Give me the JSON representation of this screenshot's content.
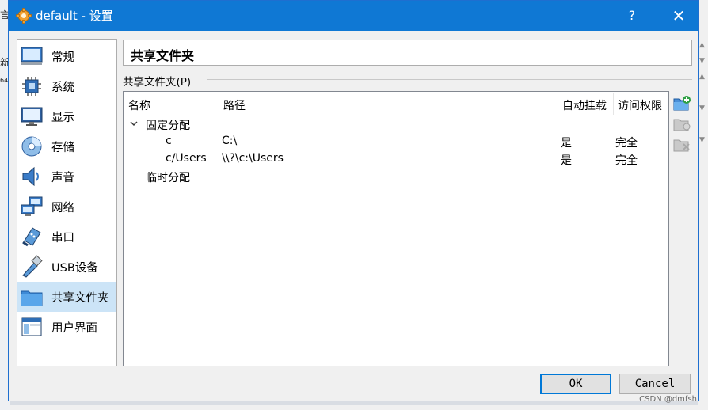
{
  "window": {
    "title": "default - 设置",
    "help_label": "?",
    "close_label": "✕",
    "title_icon": "gear-icon"
  },
  "background": {
    "left_fragments": [
      "言",
      "新",
      "64"
    ]
  },
  "nav": {
    "selected_index": 8,
    "items": [
      {
        "label": "常规",
        "icon": "monitor-general-icon"
      },
      {
        "label": "系统",
        "icon": "chip-icon"
      },
      {
        "label": "显示",
        "icon": "display-icon"
      },
      {
        "label": "存储",
        "icon": "disk-icon"
      },
      {
        "label": "声音",
        "icon": "speaker-icon"
      },
      {
        "label": "网络",
        "icon": "network-icon"
      },
      {
        "label": "串口",
        "icon": "serial-port-icon"
      },
      {
        "label": "USB设备",
        "icon": "usb-icon"
      },
      {
        "label": "共享文件夹",
        "icon": "folder-icon"
      },
      {
        "label": "用户界面",
        "icon": "window-ui-icon"
      }
    ]
  },
  "page": {
    "title": "共享文件夹",
    "group_label": "共享文件夹(P)"
  },
  "table": {
    "columns": [
      "名称",
      "路径",
      "自动挂载",
      "访问权限"
    ],
    "groups": [
      {
        "label": "固定分配",
        "expanded": true,
        "rows": [
          {
            "name": "c",
            "path": "C:\\",
            "automount": "是",
            "access": "完全"
          },
          {
            "name": "c/Users",
            "path": "\\\\?\\c:\\Users",
            "automount": "是",
            "access": "完全"
          }
        ]
      },
      {
        "label": "临时分配",
        "expanded": false,
        "rows": []
      }
    ]
  },
  "tools": [
    "add-folder-icon",
    "edit-folder-icon",
    "remove-folder-icon"
  ],
  "buttons": {
    "ok": "OK",
    "cancel": "Cancel"
  },
  "watermark": "CSDN @dmfsh"
}
